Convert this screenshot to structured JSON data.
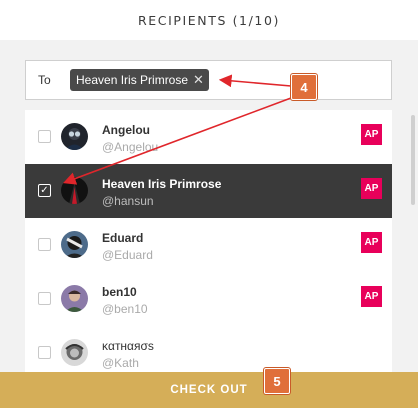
{
  "header": {
    "title": "RECIPIENTS (1/10)"
  },
  "to_bar": {
    "label": "To",
    "chip": {
      "text": "Heaven Iris Primrose",
      "remove_glyph": "✕"
    }
  },
  "recipients": [
    {
      "name": "Angelou",
      "handle": "@Angelou",
      "badge": "AP",
      "checked": false,
      "check_glyph": ""
    },
    {
      "name": "Heaven Iris Primrose",
      "handle": "@hansun",
      "badge": "AP",
      "checked": true,
      "check_glyph": "✓"
    },
    {
      "name": "Eduard",
      "handle": "@Eduard",
      "badge": "AP",
      "checked": false,
      "check_glyph": ""
    },
    {
      "name": "ben10",
      "handle": "@ben10",
      "badge": "AP",
      "checked": false,
      "check_glyph": ""
    },
    {
      "name": "ĸαтнαяσѕ",
      "handle": "@Kath",
      "badge": "",
      "checked": false,
      "check_glyph": ""
    }
  ],
  "footer": {
    "checkout_label": "CHECK OUT"
  },
  "annotations": {
    "marker_4": "4",
    "marker_5": "5"
  },
  "colors": {
    "badge": "#e8005a",
    "selected_row": "#3a3a3a",
    "checkout": "#d5ae58",
    "marker": "#e06f3a",
    "arrow": "#e0262b"
  }
}
